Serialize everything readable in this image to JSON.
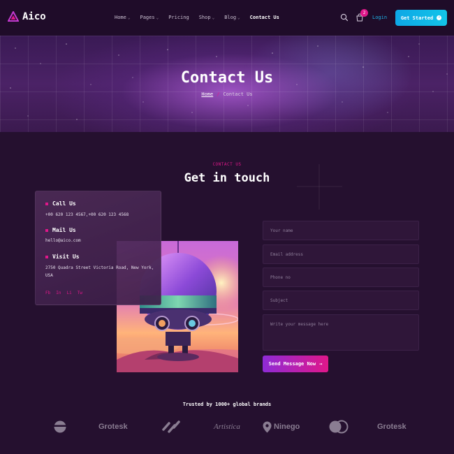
{
  "header": {
    "logo_text": "Aico",
    "nav": [
      {
        "label": "Home",
        "has_dropdown": true
      },
      {
        "label": "Pages",
        "has_dropdown": true
      },
      {
        "label": "Pricing",
        "has_dropdown": false
      },
      {
        "label": "Shop",
        "has_dropdown": true
      },
      {
        "label": "Blog",
        "has_dropdown": true
      },
      {
        "label": "Contact Us",
        "has_dropdown": false,
        "active": true
      }
    ],
    "cart_count": "2",
    "login_label": "Login",
    "cta_label": "Get Started",
    "icons": [
      "search-icon",
      "cart-icon"
    ]
  },
  "hero": {
    "title": "Contact Us",
    "breadcrumb": {
      "home": "Home",
      "separator": "/",
      "current": "Contact Us"
    }
  },
  "section": {
    "eyebrow": "CONTACT US",
    "title": "Get in touch"
  },
  "contact_info": {
    "call": {
      "heading": "Call Us",
      "text": "+00 620 123 4567,+00 620 123 4568"
    },
    "mail": {
      "heading": "Mail Us",
      "text": "hello@aico.com"
    },
    "visit": {
      "heading": "Visit Us",
      "text": "2750 Quadra Street Victoria Road, New York, USA"
    },
    "socials": [
      "Fb",
      "In",
      "Li",
      "Tw"
    ]
  },
  "form": {
    "name_placeholder": "Your name",
    "email_placeholder": "Email address",
    "phone_placeholder": "Phone no",
    "subject_placeholder": "Subject",
    "message_placeholder": "Write your message here",
    "submit_label": "Send Message Now"
  },
  "brands": {
    "heading": "Trusted by 1000+ global brands",
    "logos": [
      "Grotesk",
      "Artistica",
      "Ninego",
      "Grotesk"
    ]
  },
  "colors": {
    "background": "#25102f",
    "accent_pink": "#e0178a",
    "accent_cyan": "#13c4e8",
    "accent_purple": "#8e2bd6"
  }
}
